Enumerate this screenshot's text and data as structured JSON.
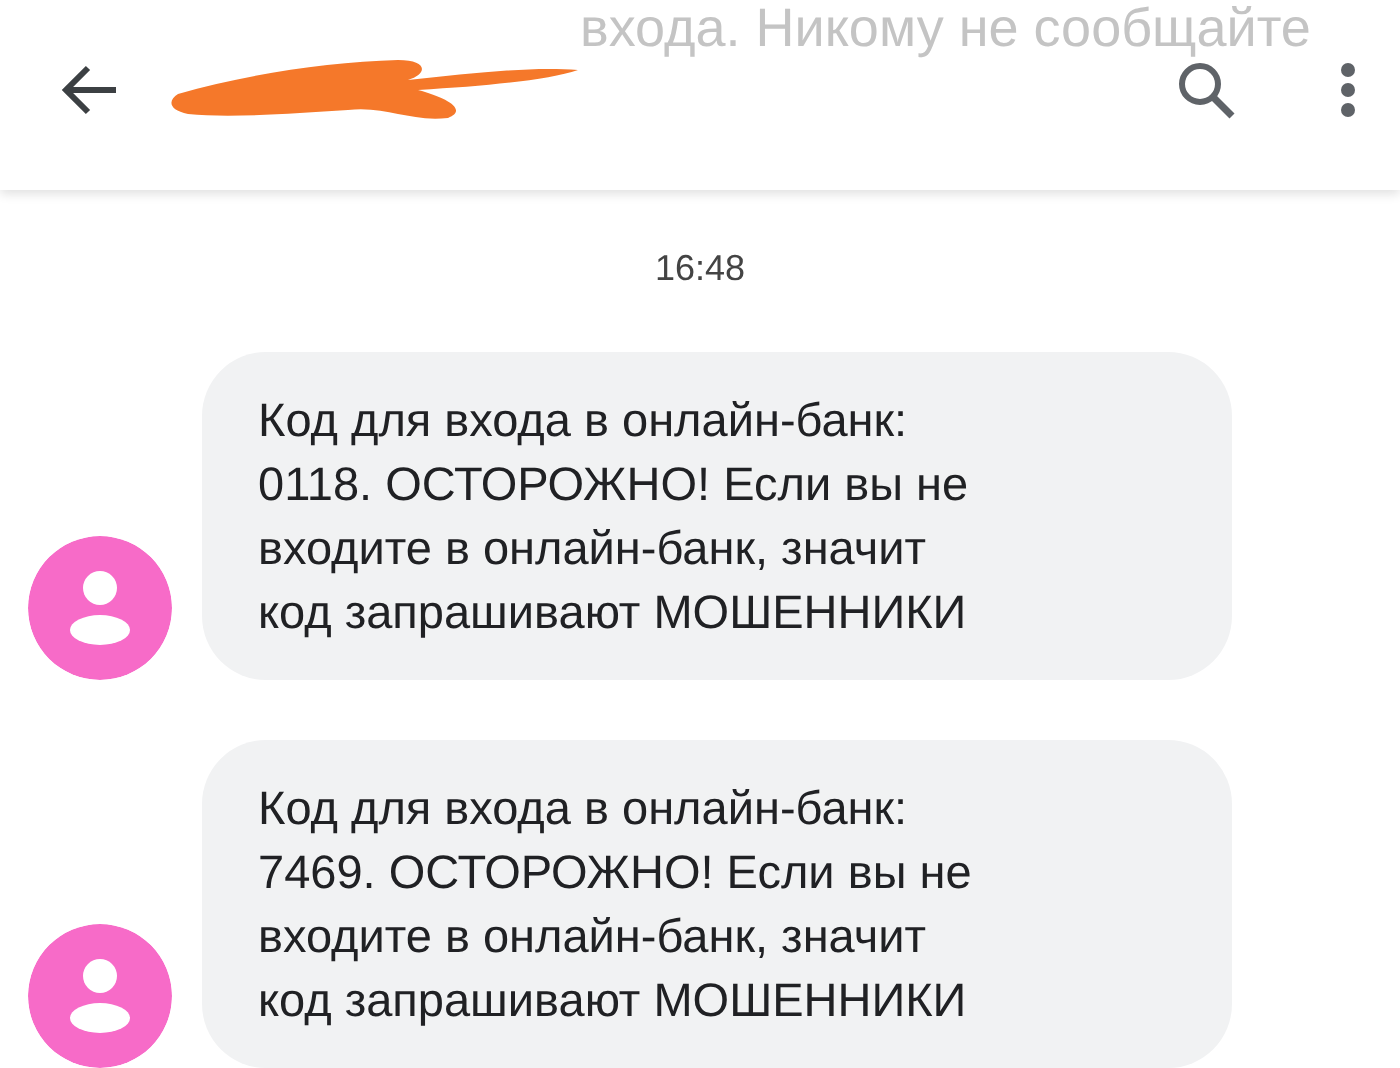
{
  "header": {
    "faded_text": "входа. Никому не сообщайте"
  },
  "timestamp": "16:48",
  "messages": [
    {
      "text": "Код для входа в онлайн-банк:\n0118. ОСТОРОЖНО! Если вы не\nвходите в онлайн-банк, значит\nкод запрашивают МОШЕННИКИ"
    },
    {
      "text": "Код для входа в онлайн-банк:\n7469. ОСТОРОЖНО! Если вы не\nвходите в онлайн-банк, значит\nкод запрашивают МОШЕННИКИ"
    }
  ]
}
